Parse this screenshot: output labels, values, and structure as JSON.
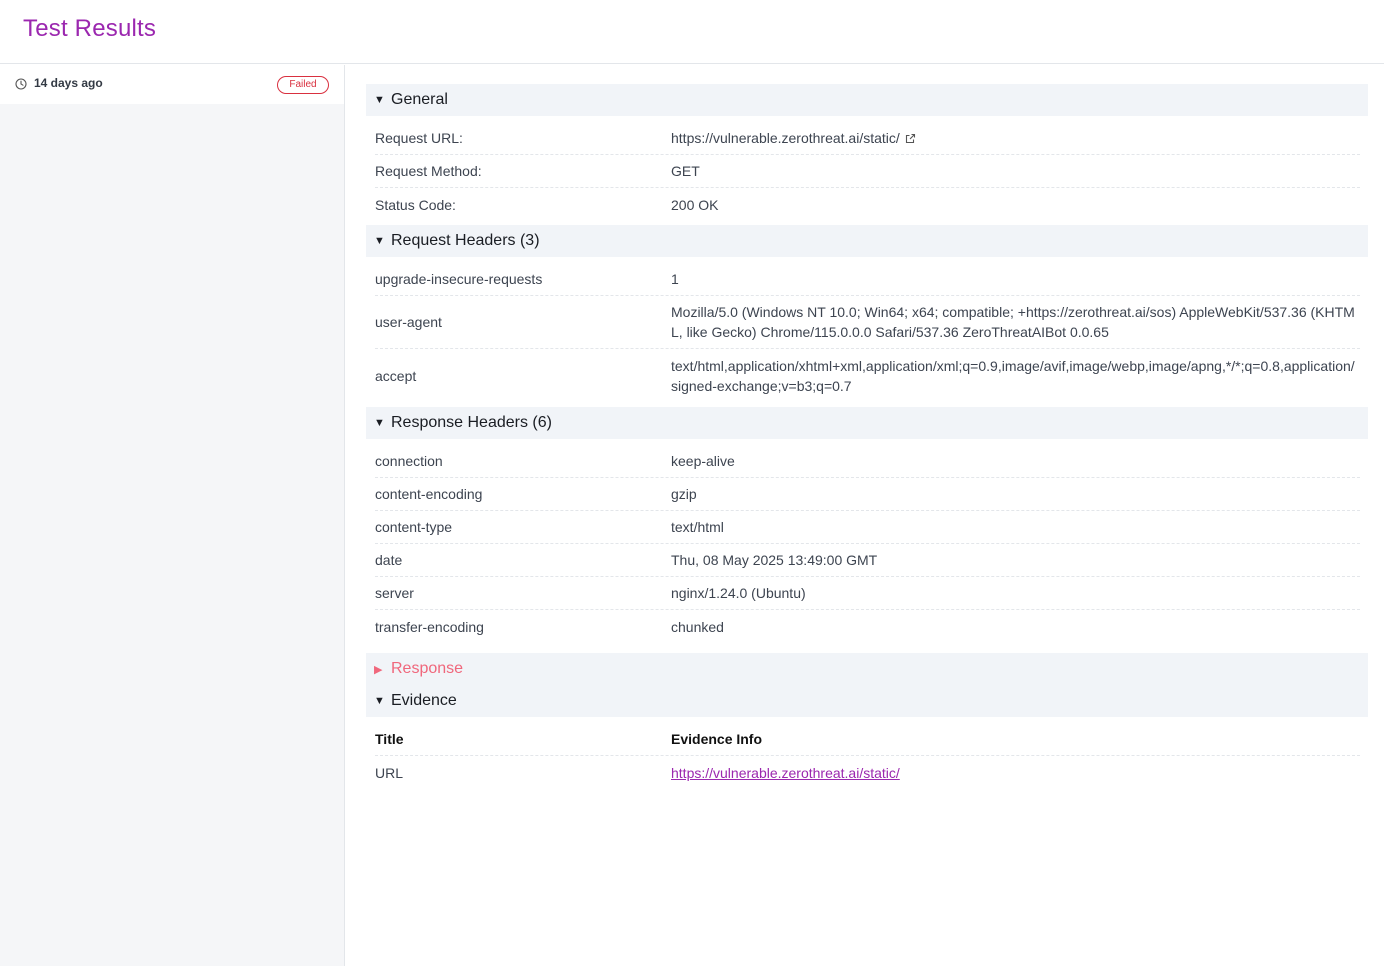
{
  "page": {
    "title": "Test Results"
  },
  "sidebar": {
    "run": {
      "time": "14 days ago",
      "status": "Failed"
    }
  },
  "general": {
    "title": "General",
    "rows": [
      {
        "key": "Request URL:",
        "value": "https://vulnerable.zerothreat.ai/static/"
      },
      {
        "key": "Request Method:",
        "value": "GET"
      },
      {
        "key": "Status Code:",
        "value": "200 OK"
      }
    ]
  },
  "request_headers": {
    "title": "Request Headers (3)",
    "rows": [
      {
        "key": "upgrade-insecure-requests",
        "value": "1"
      },
      {
        "key": "user-agent",
        "value": "Mozilla/5.0 (Windows NT 10.0; Win64; x64; compatible; +https://zerothreat.ai/sos) AppleWebKit/537.36 (KHTML, like Gecko) Chrome/115.0.0.0 Safari/537.36 ZeroThreatAIBot 0.0.65"
      },
      {
        "key": "accept",
        "value": "text/html,application/xhtml+xml,application/xml;q=0.9,image/avif,image/webp,image/apng,*/*;q=0.8,application/signed-exchange;v=b3;q=0.7"
      }
    ]
  },
  "response_headers": {
    "title": "Response Headers (6)",
    "rows": [
      {
        "key": "connection",
        "value": "keep-alive"
      },
      {
        "key": "content-encoding",
        "value": "gzip"
      },
      {
        "key": "content-type",
        "value": "text/html"
      },
      {
        "key": "date",
        "value": "Thu, 08 May 2025 13:49:00 GMT"
      },
      {
        "key": "server",
        "value": "nginx/1.24.0 (Ubuntu)"
      },
      {
        "key": "transfer-encoding",
        "value": "chunked"
      }
    ]
  },
  "response": {
    "title": "Response"
  },
  "evidence": {
    "title": "Evidence",
    "header": {
      "key": "Title",
      "value": "Evidence Info"
    },
    "rows": [
      {
        "key": "URL",
        "value": "https://vulnerable.zerothreat.ai/static/"
      }
    ]
  },
  "colors": {
    "accent": "#9b27af",
    "failed": "#d9303f",
    "collapsed": "#f0677c",
    "section_bg": "#f1f4f8"
  }
}
